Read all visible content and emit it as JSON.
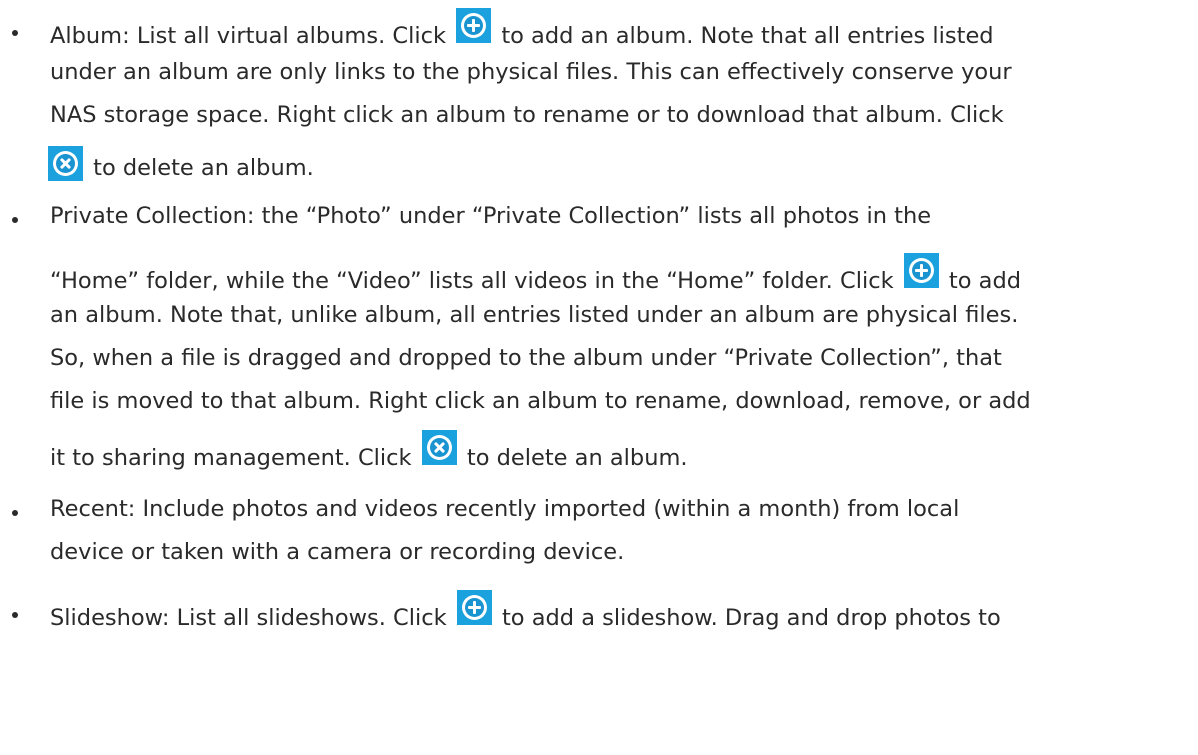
{
  "items": [
    {
      "lines": {
        "l1a": "Album: List all virtual albums. Click",
        "l1b": "to add an album. Note that all entries listed",
        "l2": "under an album are only links to the physical files. This can effectively conserve your",
        "l3": "NAS storage space. Right click an album to rename or to download that album. Click",
        "l4b": "to delete an album."
      }
    },
    {
      "lines": {
        "l1": "Private Collection: the “Photo” under “Private Collection” lists all photos in the",
        "l2a": "“Home” folder, while the “Video” lists all videos in the “Home” folder. Click",
        "l2b": "to add",
        "l3": "an album. Note that, unlike album, all entries listed under an album are physical files.",
        "l4": "So, when a file is dragged and dropped to the album under “Private Collection”, that",
        "l5": "file is moved to that album. Right click an album to rename, download, remove, or add",
        "l6a": "it to sharing management.  Click",
        "l6b": "to delete an album."
      }
    },
    {
      "lines": {
        "l1": "Recent: Include photos and videos recently imported (within a month) from local",
        "l2": "device or taken with a camera or recording device."
      }
    },
    {
      "lines": {
        "l1a": "Slideshow: List all slideshows. Click",
        "l1b": "to add a slideshow. Drag and drop photos to"
      }
    }
  ],
  "icons": {
    "add": "add-circle-icon",
    "delete": "delete-circle-icon",
    "accent": "#1aa1de"
  }
}
